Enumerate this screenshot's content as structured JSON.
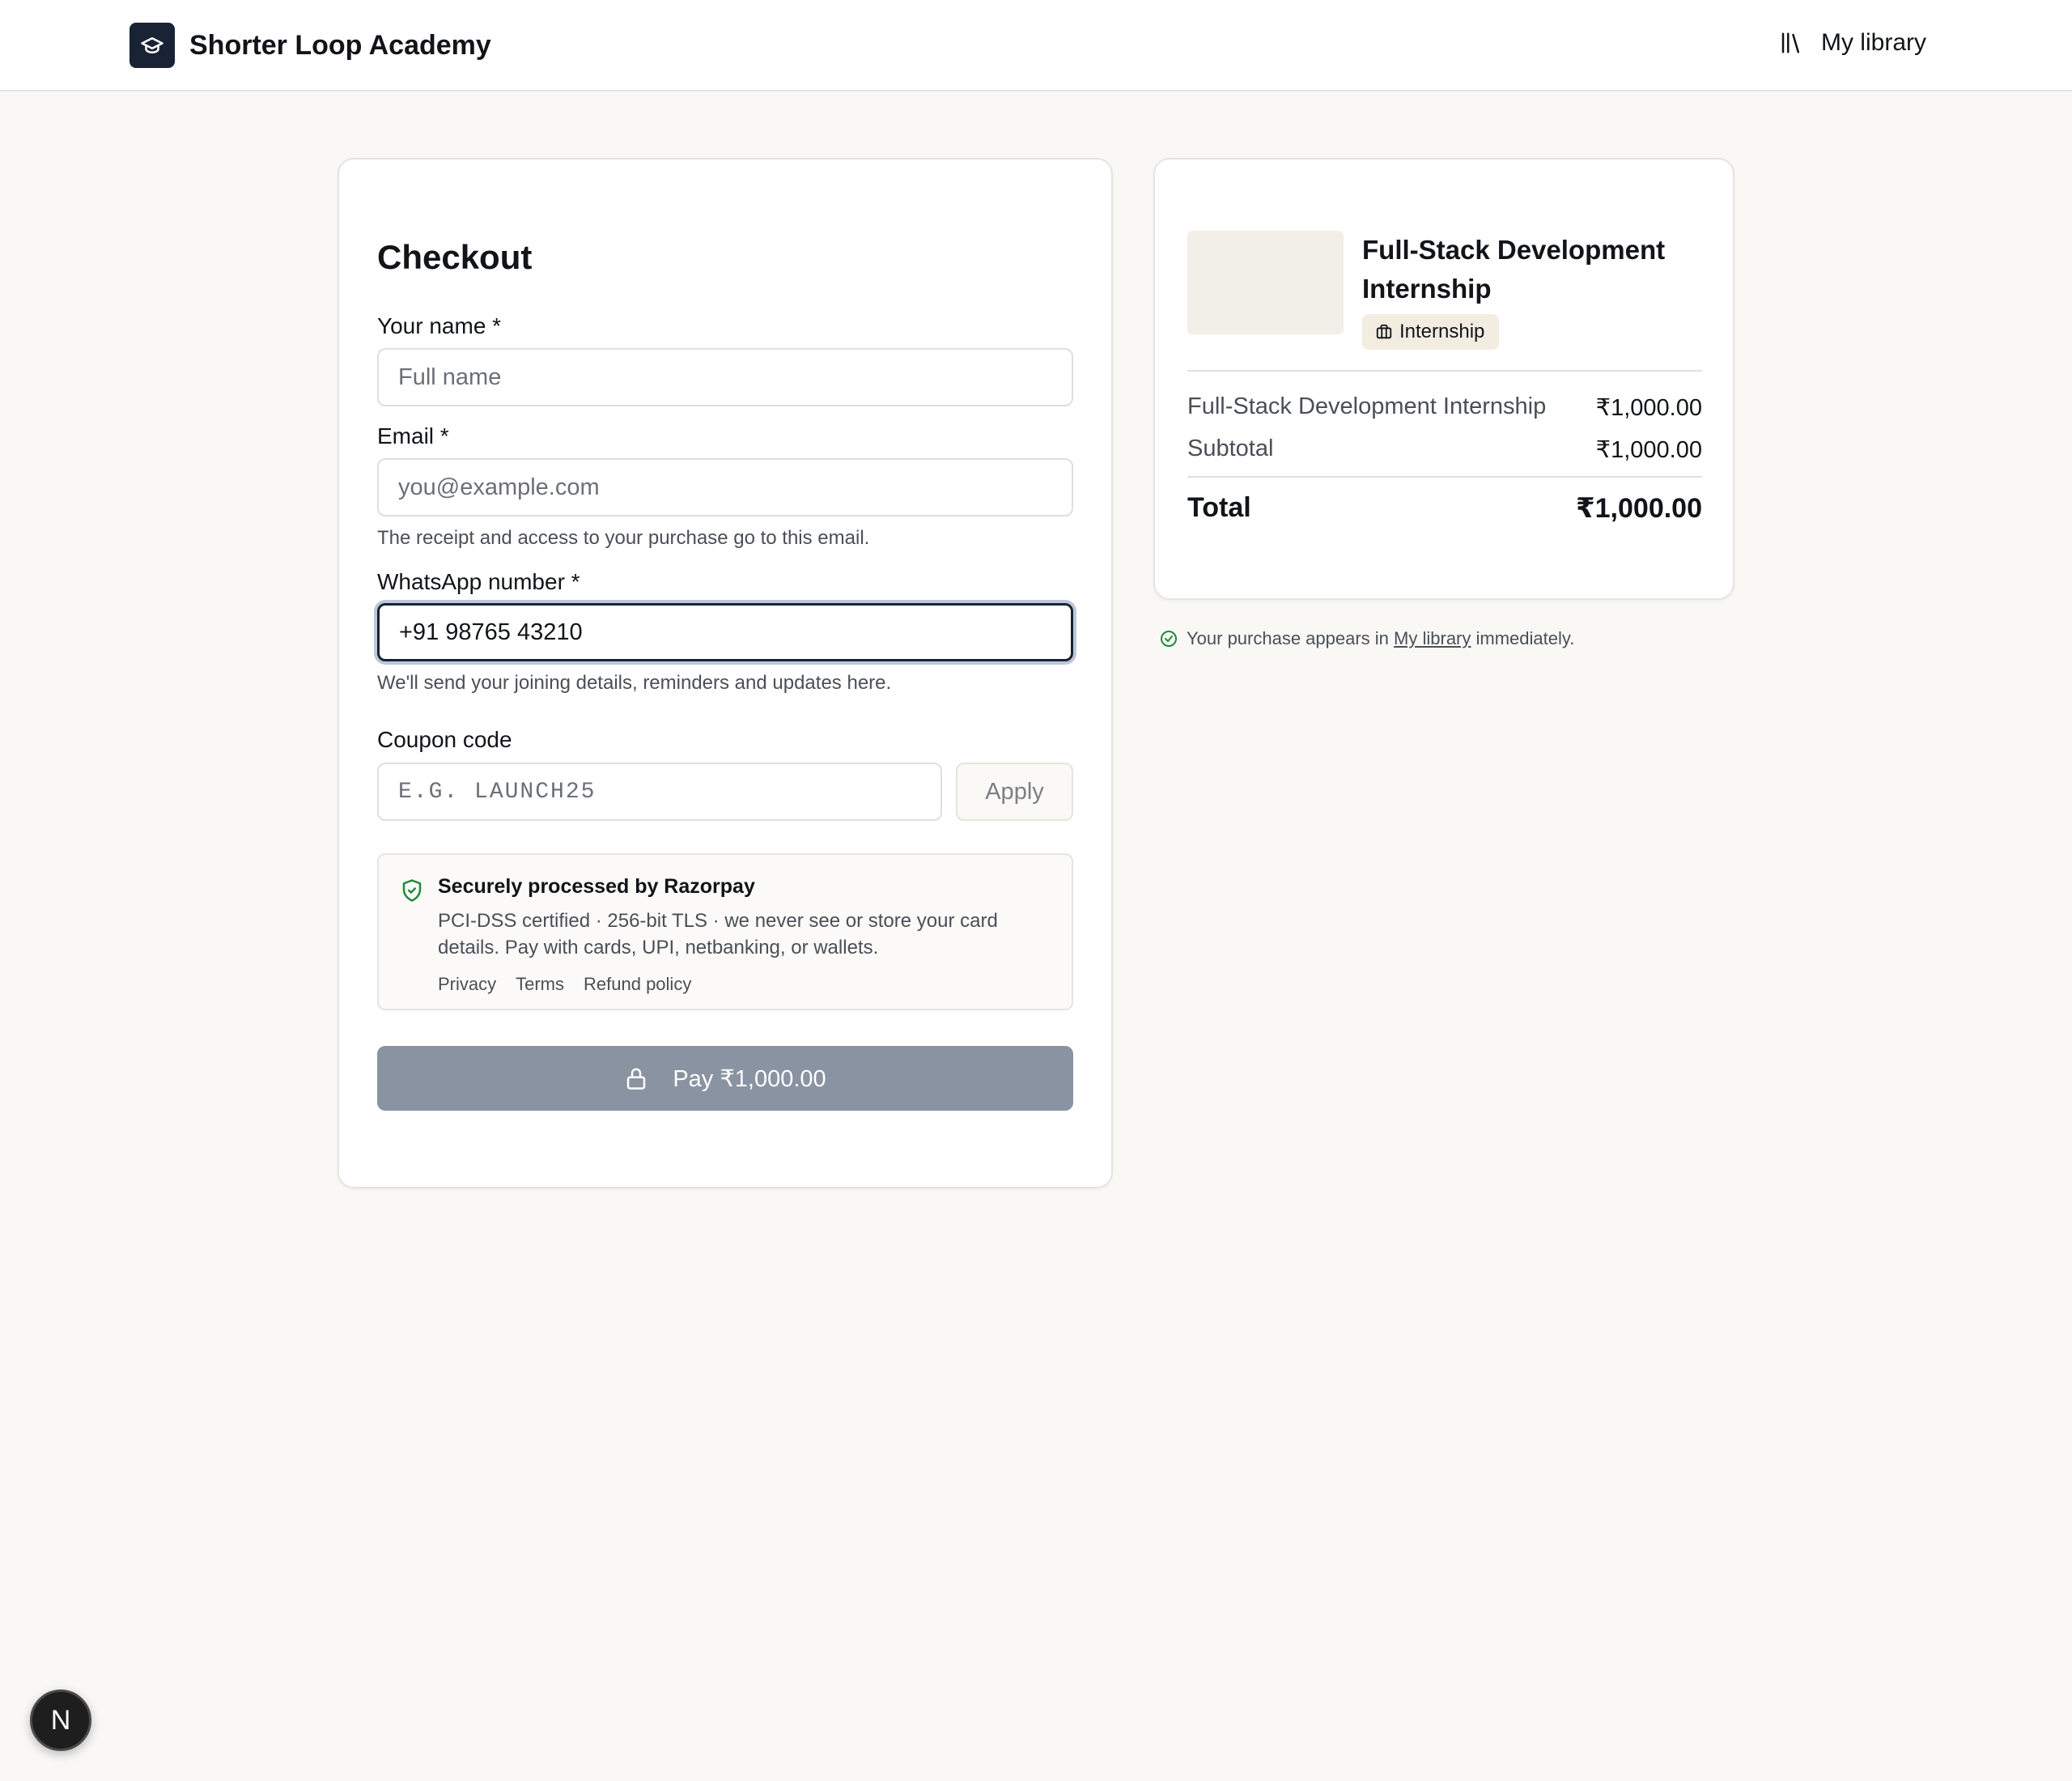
{
  "header": {
    "brand_name": "Shorter Loop Academy",
    "library_label": "My library"
  },
  "checkout": {
    "title": "Checkout",
    "name": {
      "label": "Your name *",
      "placeholder": "Full name",
      "value": ""
    },
    "email": {
      "label": "Email *",
      "placeholder": "you@example.com",
      "value": "",
      "hint": "The receipt and access to your purchase go to this email."
    },
    "whatsapp": {
      "label": "WhatsApp number *",
      "value": "+91 98765 43210",
      "hint": "We'll send your joining details, reminders and updates here."
    },
    "coupon": {
      "label": "Coupon code",
      "placeholder": "E.G. LAUNCH25",
      "apply_label": "Apply"
    },
    "secure": {
      "title": "Securely processed by Razorpay",
      "description": "PCI-DSS certified · 256-bit TLS · we never see or store your card details. Pay with cards, UPI, netbanking, or wallets.",
      "links": [
        "Privacy",
        "Terms",
        "Refund policy"
      ]
    },
    "pay_label": "Pay ₹1,000.00"
  },
  "summary": {
    "product_title": "Full-Stack Development Internship",
    "badge": "Internship",
    "line_item_name": "Full-Stack Development Internship",
    "line_item_price": "₹1,000.00",
    "subtotal_label": "Subtotal",
    "subtotal_value": "₹1,000.00",
    "total_label": "Total",
    "total_value": "₹1,000.00"
  },
  "library_note": {
    "before": "Your purchase appears in",
    "link": "My library",
    "after": "immediately."
  },
  "dev_badge": "N",
  "colors": {
    "brand_dark": "#1a2235",
    "pay_button_disabled": "#8993a1",
    "success_green": "#1f8a3b",
    "page_bg": "#f9f8f5"
  }
}
